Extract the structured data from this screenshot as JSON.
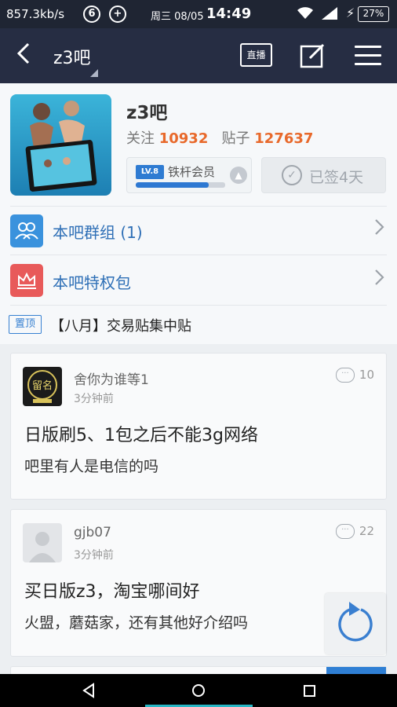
{
  "status_bar": {
    "network_speed": "857.3kb/s",
    "icon1": "6",
    "icon2": "+",
    "day": "周三 08/05",
    "time": "14:49",
    "battery": "27%",
    "icons": [
      "wifi-icon",
      "signal-icon",
      "charging-icon",
      "battery-icon"
    ]
  },
  "nav": {
    "title": "z3吧",
    "live_label": "直播",
    "icons": [
      "back-icon",
      "edit-icon",
      "menu-icon"
    ]
  },
  "forum": {
    "name": "z3吧",
    "follow_label": "关注",
    "follow_count": "10932",
    "posts_label": "贴子",
    "posts_count": "127637",
    "level_badge": "LV.8",
    "member_title": "铁杆会员",
    "level_progress": 0.82,
    "sign_label": "已签4天"
  },
  "rows": {
    "groups_label": "本吧群组 (1)",
    "privilege_label": "本吧特权包",
    "pinned_badge": "置顶",
    "pinned_text": "【八月】交易贴集中贴"
  },
  "posts": [
    {
      "user": "舍你为谁等1",
      "time": "3分钟前",
      "comments": "10",
      "title": "日版刷5、1包之后不能3g网络",
      "body": "吧里有人是电信的吗",
      "avatar_text": "留名"
    },
    {
      "user": "gjb07",
      "time": "3分钟前",
      "comments": "22",
      "title": "买日版z3，淘宝哪间好",
      "body": "火盟，蘑菇家，还有其他好介绍吗"
    }
  ],
  "colors": {
    "nav_bg": "#262d43",
    "accent_blue": "#2e6fb6",
    "count_orange": "#e8692b"
  }
}
